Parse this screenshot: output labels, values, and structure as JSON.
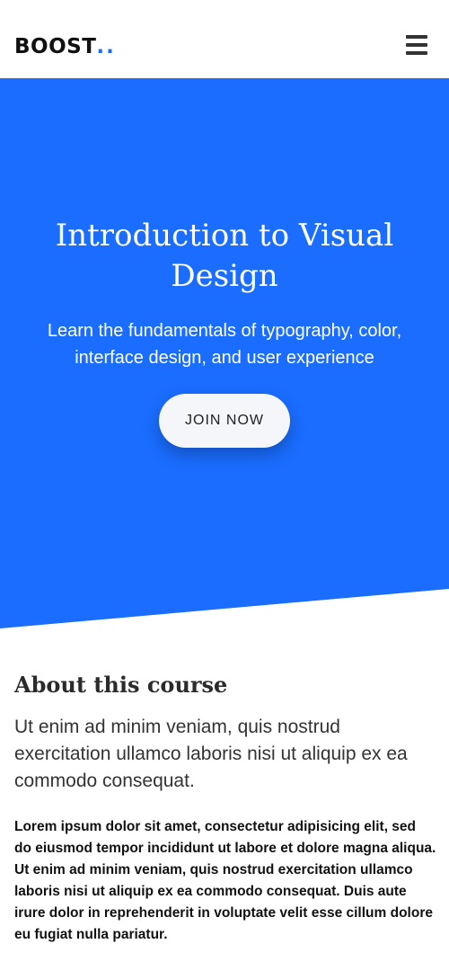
{
  "header": {
    "logo_text": "BOOST",
    "logo_dots": "..",
    "menu_icon": "hamburger-menu-icon"
  },
  "hero": {
    "title": "Introduction to Visual Design",
    "subtitle": "Learn the fundamentals of typography, color, interface design, and user experience",
    "cta_label": "JOIN NOW"
  },
  "about": {
    "heading": "About this course",
    "lead": "Ut enim ad minim veniam, quis nostrud exercitation ullamco laboris nisi ut aliquip ex ea commodo consequat.",
    "body": "Lorem ipsum dolor sit amet, consectetur adipisicing elit, sed do eiusmod tempor incididunt ut labore et dolore magna aliqua. Ut enim ad minim veniam, quis nostrud exercitation ullamco laboris nisi ut aliquip ex ea commodo consequat. Duis aute irure dolor in reprehenderit in voluptate velit esse cillum dolore eu fugiat nulla pariatur."
  },
  "colors": {
    "accent": "#1a6dff",
    "hero_background": "#1a6dff",
    "button_background": "#f5f6fa"
  }
}
